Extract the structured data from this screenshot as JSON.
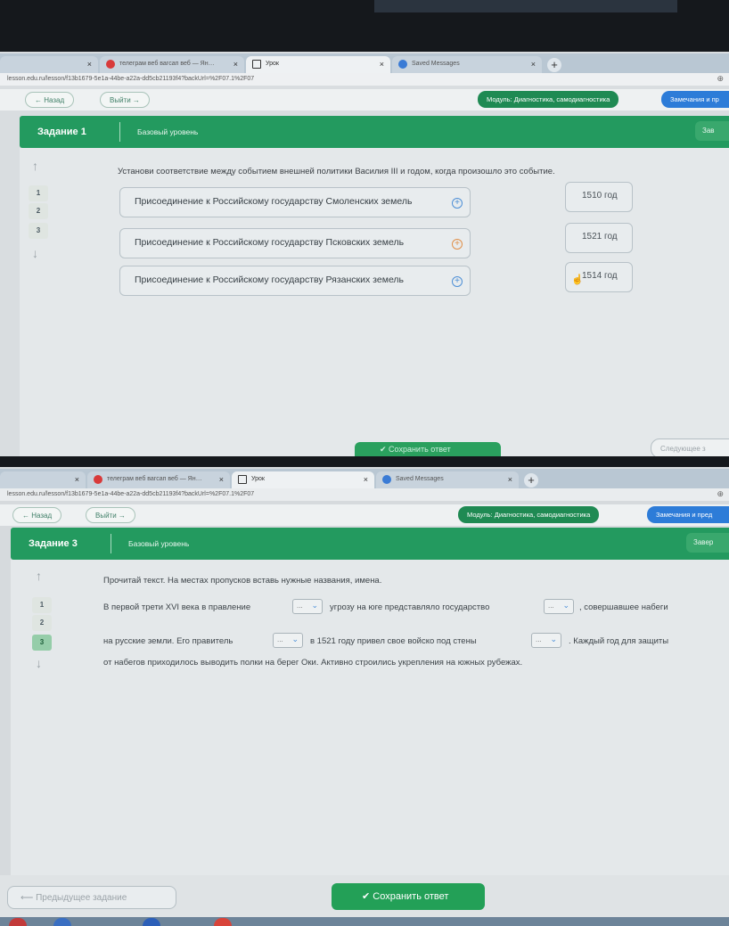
{
  "browser": {
    "tabs": [
      {
        "label": "",
        "close": "×"
      },
      {
        "label": "телеграм веб вагсап веб — Ян…",
        "close": "×"
      },
      {
        "label": "Урок",
        "close": "×"
      },
      {
        "label": "Saved Messages",
        "close": "×"
      }
    ],
    "new_tab": "+",
    "url_1": "lesson.edu.ru/lesson/f13b1679-5e1a-44be-a22a-dd5cb21193f4?backUrl=%2F07.1%2F07",
    "url_2": "lesson.edu.ru/lesson/f13b1679-5e1a-44be-a22a-dd5cb21193f4?backUrl=%2F07.1%2F07"
  },
  "toolbar": {
    "back_label": "← Назад",
    "exit_label": "Выйти →",
    "module_label": "Модуль: Диагностика, самодиагностика",
    "remarks_label_1": "Замечания и пр",
    "remarks_label_2": "Замечания и пред"
  },
  "task1": {
    "title": "Задание 1",
    "level": "Базовый уровень",
    "finish_label": "Зав",
    "nav": [
      "1",
      "2",
      "3"
    ],
    "question": "Установи соответствие между событием внешней политики Василия III и годом, когда произошло это событие.",
    "events": [
      "Присоединение к Российскому государству Смоленских земель",
      "Присоединение к Российскому государству Псковских земель",
      "Присоединение к Российскому государству Рязанских земель"
    ],
    "years": [
      "1510 год",
      "1521 год",
      "1514 год"
    ],
    "save_label": "✔ Сохранить ответ",
    "next_label": "Следующее з"
  },
  "task3": {
    "title": "Задание 3",
    "level": "Базовый уровень",
    "finish_label": "Завер",
    "nav": [
      "1",
      "2",
      "3"
    ],
    "instruction": "Прочитай текст. На местах пропусков вставь нужные названия, имена.",
    "line1_a": "В первой трети XVI века в правление",
    "line1_b": "угрозу на юге представляло государство",
    "line1_c": ", совершавшее набеги",
    "line2_a": "на русские земли. Его правитель",
    "line2_b": "в 1521 году привел свое войско под стены",
    "line2_c": ". Каждый год для защиты",
    "line3": "от набегов приходилось выводить полки на берег Оки. Активно строились укрепления на южных рубежах.",
    "dropdown_placeholder": "...",
    "prev_label": "⟵ Предыдущее задание",
    "save_label": "✔  Сохранить ответ"
  },
  "colors": {
    "accent_green": "#239a5f",
    "module_green": "#1f8a53",
    "remarks_blue": "#2d7cd8",
    "current_nav": "#95cda9"
  }
}
